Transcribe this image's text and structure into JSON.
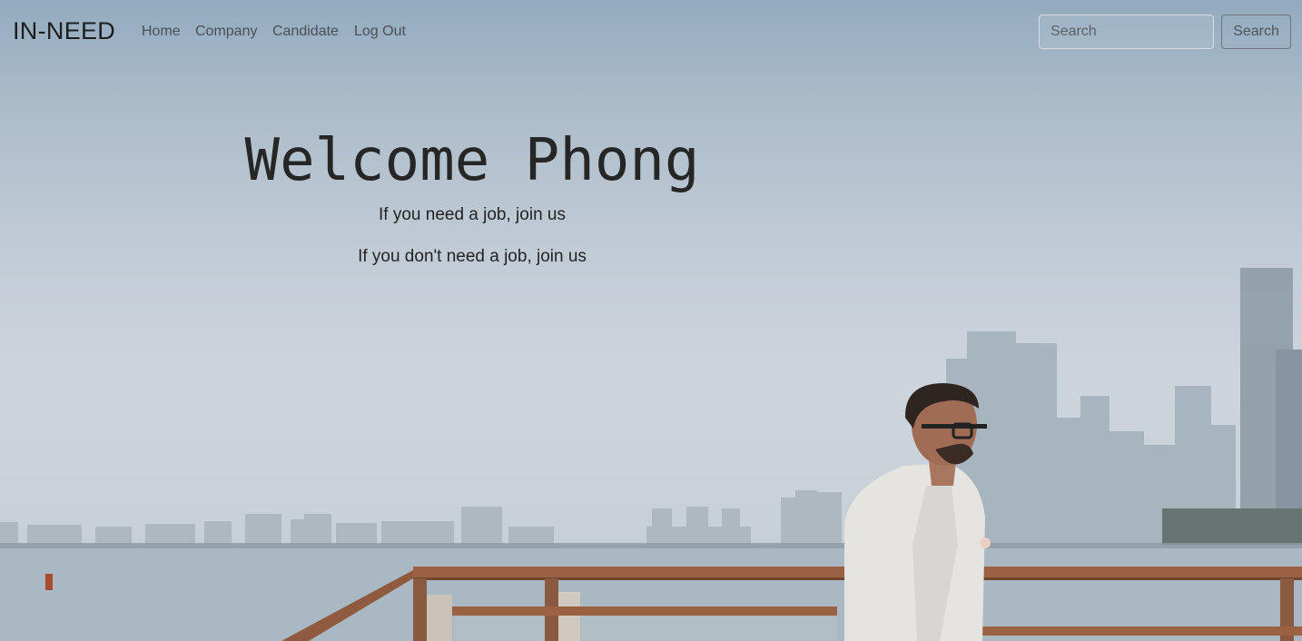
{
  "navbar": {
    "brand": "IN-NEED",
    "links": [
      "Home",
      "Company",
      "Candidate",
      "Log Out"
    ],
    "search": {
      "placeholder": "Search",
      "button_label": "Search"
    }
  },
  "hero": {
    "title": "Welcome Phong",
    "line1": "If you need a job, join us",
    "line2": "If you don't need a job, join us"
  },
  "background": {
    "scene": "man-in-suit-by-waterfront-city-skyline-photo"
  }
}
